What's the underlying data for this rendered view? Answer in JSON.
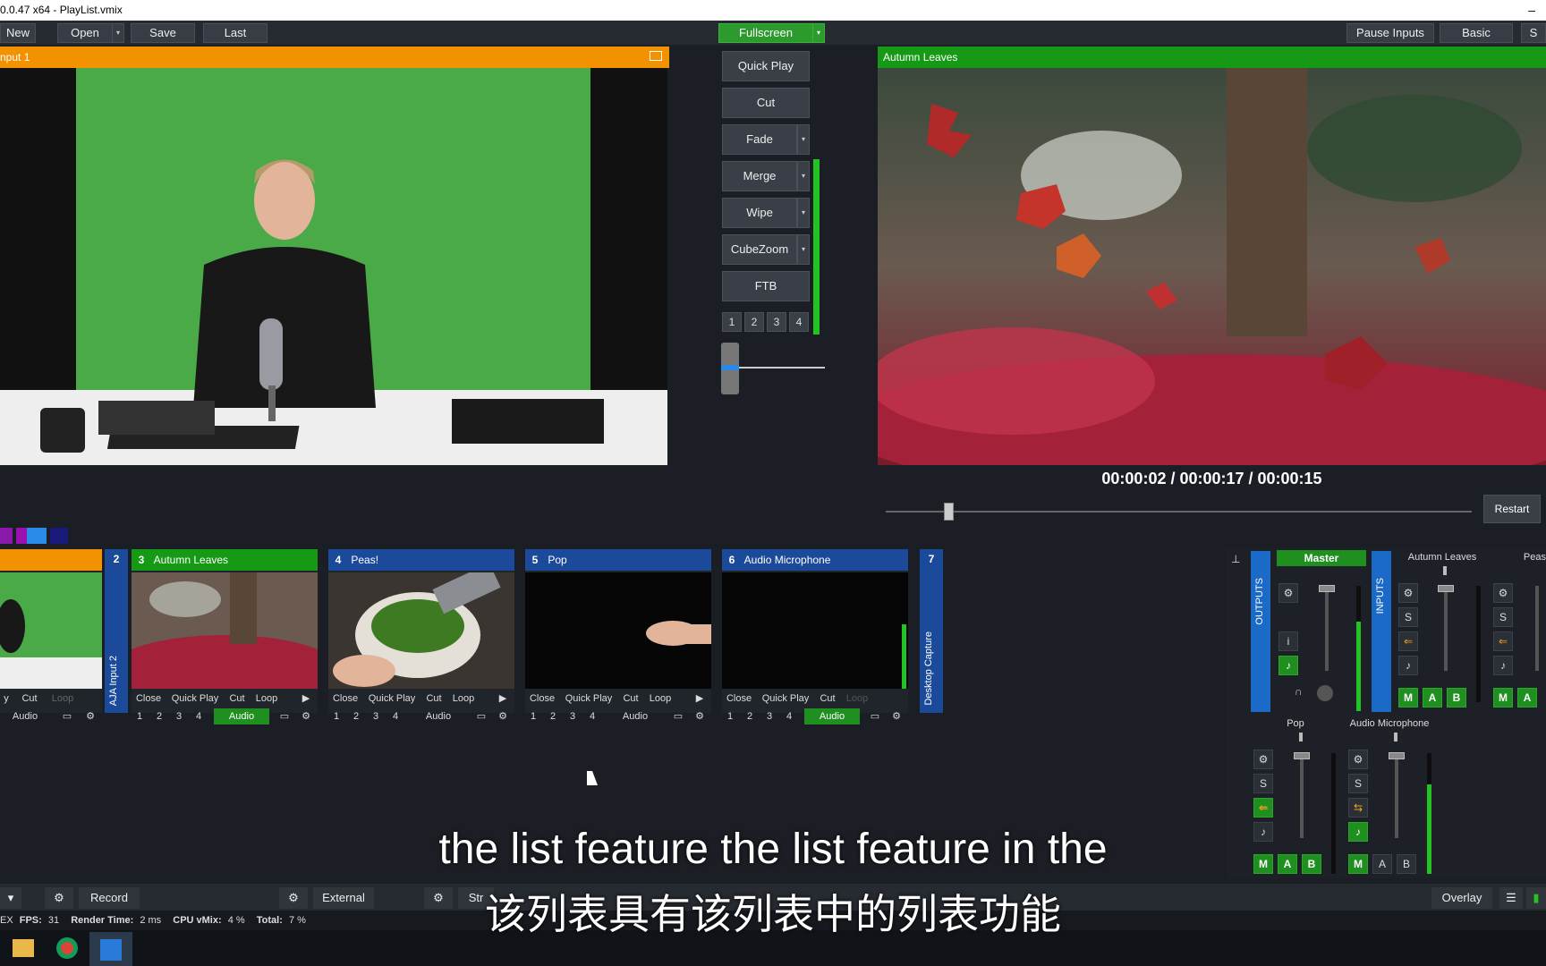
{
  "window": {
    "title": "0.0.47 x64 - PlayList.vmix",
    "minimize": "–"
  },
  "toolbar": {
    "new": "New",
    "open": "Open",
    "save": "Save",
    "last": "Last",
    "fullscreen": "Fullscreen",
    "pause_inputs": "Pause Inputs",
    "basic": "Basic",
    "s": "S",
    "dd": "▾"
  },
  "preview": {
    "title": "nput 1"
  },
  "program": {
    "title": "Autumn Leaves"
  },
  "transitions": {
    "quick_play": "Quick Play",
    "cut": "Cut",
    "fade": "Fade",
    "merge": "Merge",
    "wipe": "Wipe",
    "cubezoom": "CubeZoom",
    "ftb": "FTB",
    "nums": [
      "1",
      "2",
      "3",
      "4"
    ]
  },
  "timecode": {
    "text": "00:00:02  /  00:00:17  /  00:00:15",
    "restart": "Restart"
  },
  "colors": {
    "accent_orange": "#f39200",
    "program_green": "#169a16",
    "input_blue": "#1c4a9a"
  },
  "inputs": [
    {
      "num": "",
      "title": "",
      "row1": [
        "y",
        "Cut",
        "Loop"
      ],
      "audio": "Audio"
    },
    {
      "num": "2",
      "vertical": "AJA Input 2"
    },
    {
      "num": "3",
      "title": "Autumn Leaves",
      "row1": [
        "Close",
        "Quick Play",
        "Cut",
        "Loop"
      ],
      "nums": [
        "1",
        "2",
        "3",
        "4"
      ],
      "audio": "Audio"
    },
    {
      "num": "4",
      "title": "Peas!",
      "row1": [
        "Close",
        "Quick Play",
        "Cut",
        "Loop"
      ],
      "nums": [
        "1",
        "2",
        "3",
        "4"
      ],
      "audio": "Audio"
    },
    {
      "num": "5",
      "title": "Pop",
      "row1": [
        "Close",
        "Quick Play",
        "Cut",
        "Loop"
      ],
      "nums": [
        "1",
        "2",
        "3",
        "4"
      ],
      "audio": "Audio"
    },
    {
      "num": "6",
      "title": "Audio Microphone",
      "row1": [
        "Close",
        "Quick Play",
        "Cut",
        "Loop"
      ],
      "nums": [
        "1",
        "2",
        "3",
        "4"
      ],
      "audio": "Audio"
    },
    {
      "num": "7",
      "vertical": "Desktop Capture"
    }
  ],
  "mixer": {
    "outputs_label": "OUTPUTS",
    "inputs_label": "INPUTS",
    "master": "Master",
    "autumn": "Autumn Leaves",
    "peas": "Peas",
    "pop": "Pop",
    "mic": "Audio Microphone",
    "s": "S",
    "i": "i",
    "m": "M",
    "a": "A",
    "b": "B"
  },
  "bottom": {
    "record": "Record",
    "external": "External",
    "stream": "Str",
    "overlay": "Overlay"
  },
  "status": {
    "fps_label": "FPS:",
    "fps": "31",
    "render_label": "Render Time:",
    "render": "2 ms",
    "cpu_label": "CPU vMix:",
    "cpu": "4 %",
    "total_label": "Total:",
    "total": "7 %",
    "ex": "EX"
  },
  "subtitles": {
    "en": "the list feature the list feature in the",
    "zh": "该列表具有该列表中的列表功能"
  }
}
